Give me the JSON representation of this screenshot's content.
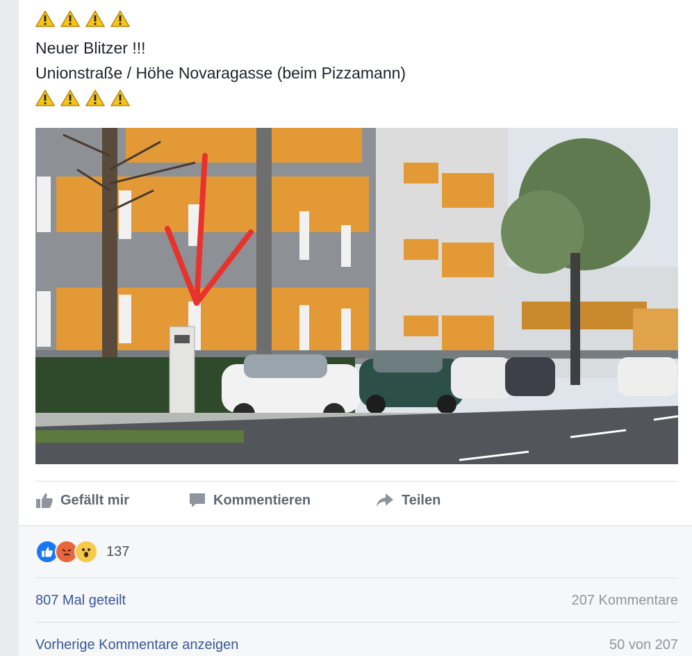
{
  "post": {
    "warning_icon": "warning-icon",
    "line1": "Neuer Blitzer !!!",
    "line2": "Unionstraße / Höhe Novaragasse (beim Pizzamann)"
  },
  "actions": {
    "like": {
      "label": "Gefällt mir",
      "icon": "thumbs-up-icon"
    },
    "comment": {
      "label": "Kommentieren",
      "icon": "comment-icon"
    },
    "share": {
      "label": "Teilen",
      "icon": "share-arrow-icon"
    }
  },
  "reactions": {
    "icons": [
      "like-reaction-icon",
      "angry-reaction-icon",
      "wow-reaction-icon"
    ],
    "count": "137"
  },
  "stats": {
    "shares": "807 Mal geteilt",
    "comments": "207 Kommentare"
  },
  "comments": {
    "previous_link": "Vorherige Kommentare anzeigen",
    "pager": "50 von 207"
  },
  "colors": {
    "link": "#365899",
    "like_blue": "#1877f2",
    "angry": "#e8663d",
    "wow": "#f7c948",
    "arrow_red": "#e8322d"
  }
}
